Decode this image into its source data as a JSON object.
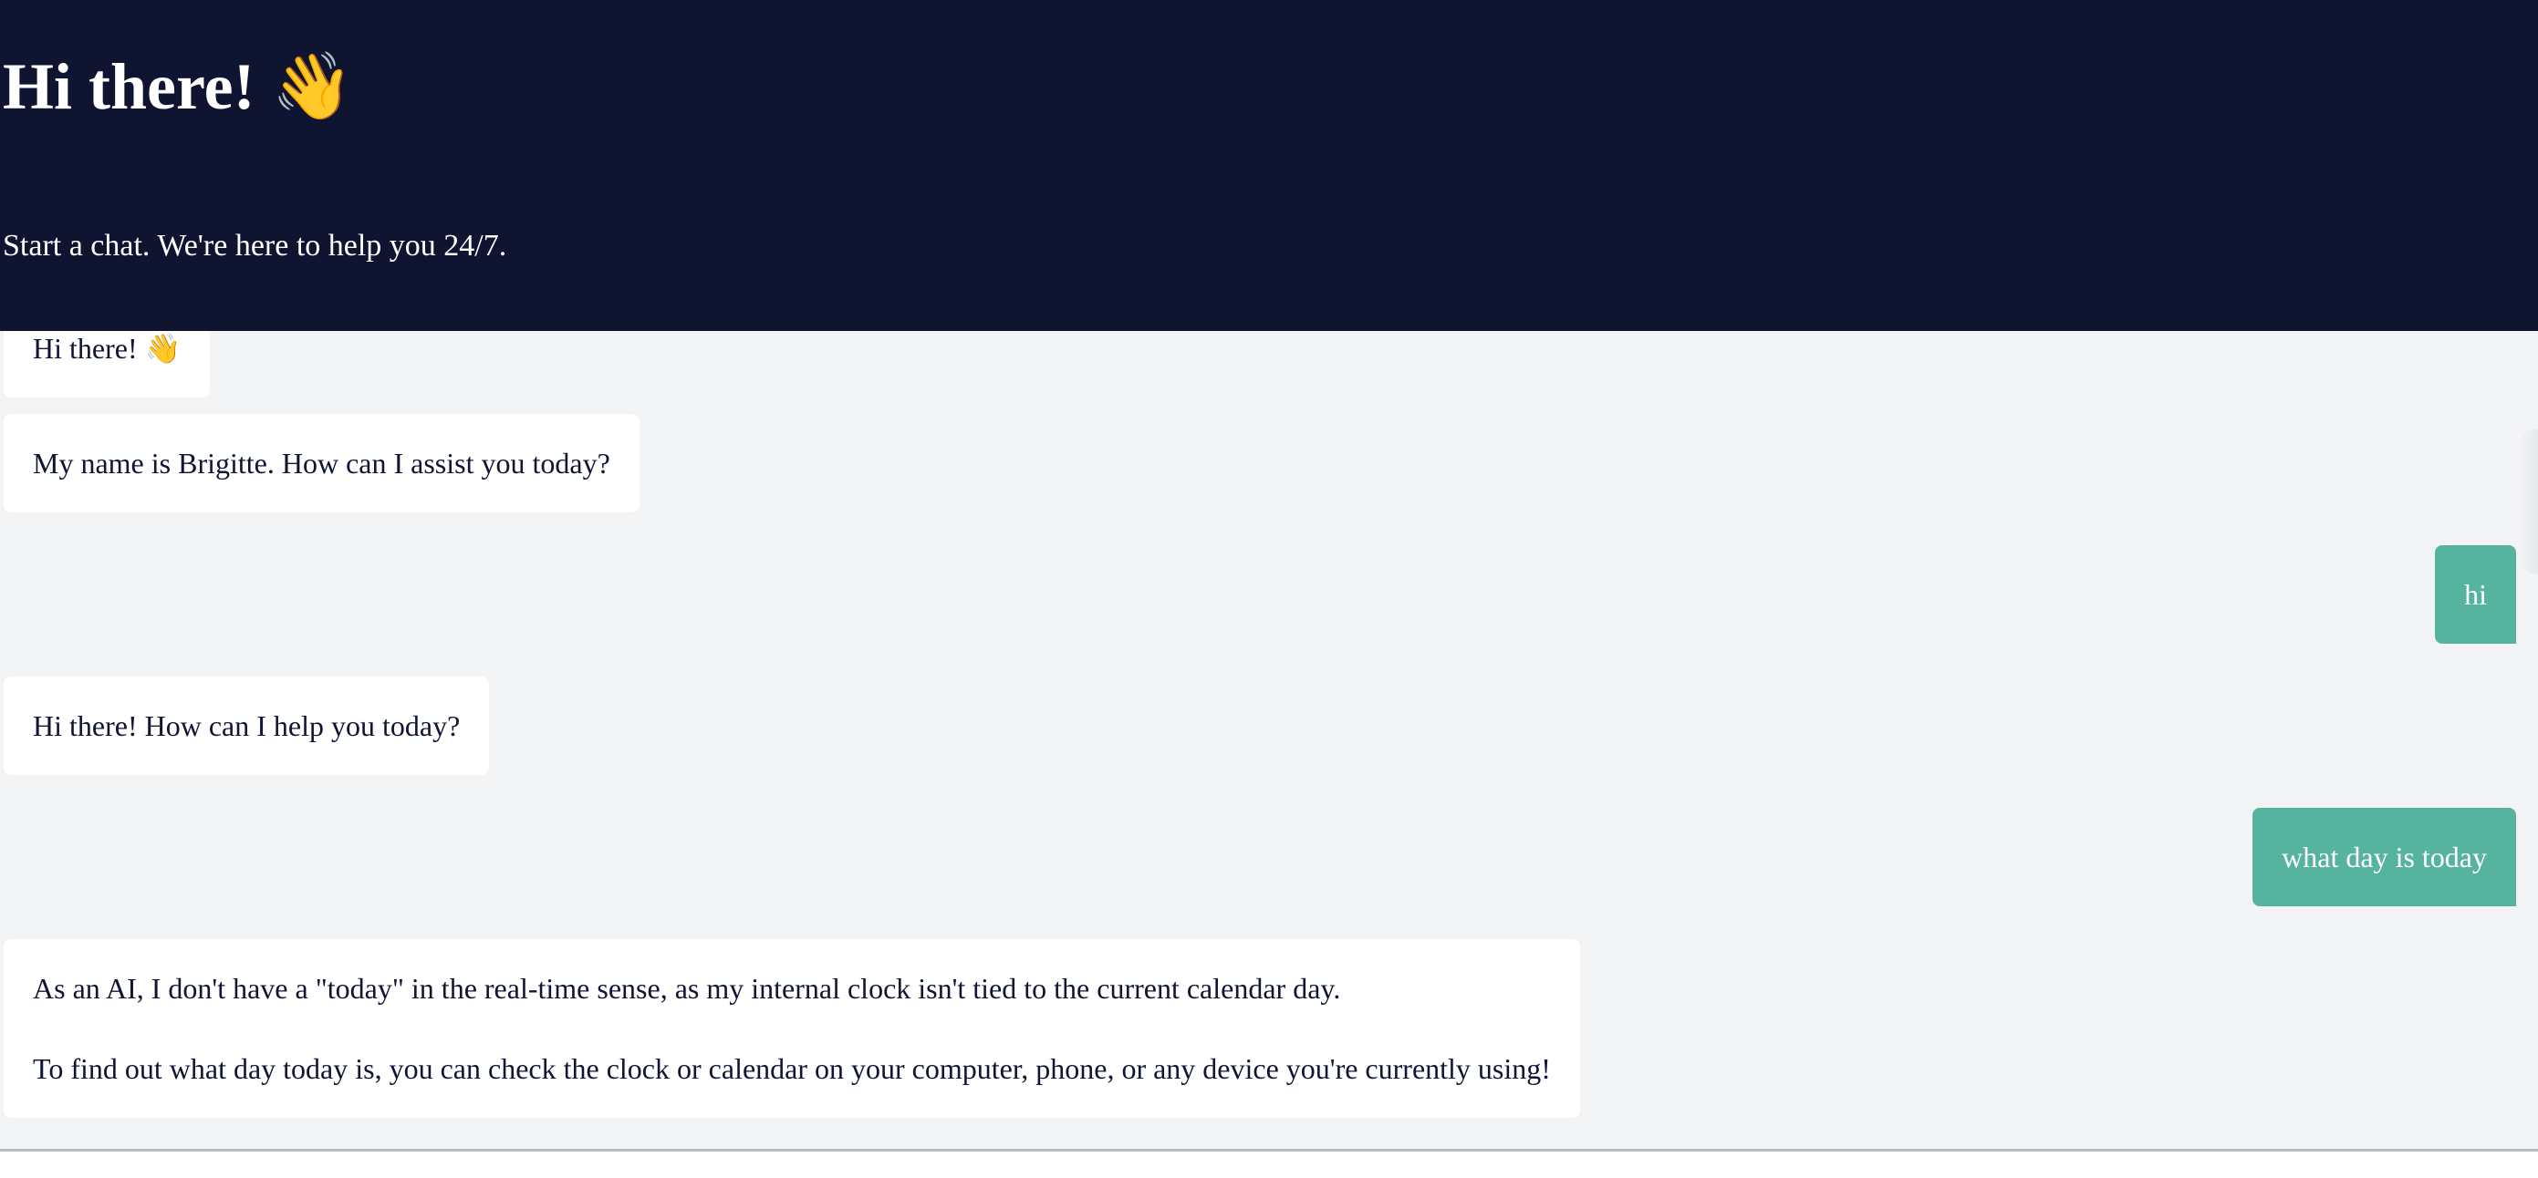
{
  "header": {
    "title": "Hi there! 👋",
    "subtitle": "Start a chat. We're here to help you 24/7."
  },
  "messages": [
    {
      "role": "bot",
      "text": "Hi there! 👋"
    },
    {
      "role": "bot",
      "text": "My name is Brigitte. How can I assist you today?"
    },
    {
      "role": "user",
      "text": "hi"
    },
    {
      "role": "bot",
      "text": "Hi there! How can I help you today?"
    },
    {
      "role": "user",
      "text": "what day is today"
    },
    {
      "role": "bot",
      "paragraphs": [
        "As an AI, I don't have a \"today\" in the real-time sense, as my internal clock isn't tied to the current calendar day.",
        "To find out what day today is, you can check the clock or calendar on your computer, phone, or any device you're currently using!"
      ]
    }
  ],
  "colors": {
    "header_bg": "#0f1430",
    "page_bg": "#f3f4f6",
    "bot_bubble": "#ffffff",
    "user_bubble": "#56b39d",
    "text_dark": "#0f1533"
  }
}
